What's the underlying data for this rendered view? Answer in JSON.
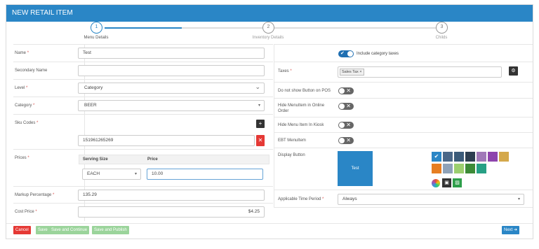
{
  "title": "NEW RETAIL ITEM",
  "steps": [
    {
      "num": "1",
      "label": "Menu Details"
    },
    {
      "num": "2",
      "label": "Inventory Details"
    },
    {
      "num": "3",
      "label": "Childs"
    }
  ],
  "form": {
    "name": {
      "label": "Name",
      "value": "Test"
    },
    "secondary_name": {
      "label": "Secondary Name",
      "value": ""
    },
    "level": {
      "label": "Level",
      "value": "Category"
    },
    "category": {
      "label": "Category",
      "value": "BEER"
    },
    "sku": {
      "label": "Sku Codes",
      "value": "151961265269"
    },
    "prices": {
      "label": "Prices",
      "col_size": "Serving Size",
      "col_price": "Price",
      "size": "EACH",
      "price": "10.00"
    },
    "markup": {
      "label": "Markup Percentage",
      "value": "135.29"
    },
    "cost": {
      "label": "Cost Price",
      "value": "$4.25"
    }
  },
  "right": {
    "include_taxes": "Include category taxes",
    "taxes": {
      "label": "Taxes",
      "tag": "Sales Tax ×"
    },
    "no_show_pos": "Do not show Button on POS",
    "hide_online": "Hide MenuItem in Online Order",
    "hide_kiosk": "Hide Menu Item In Kiosk",
    "ebt": "EBT MenuItem",
    "display_button": {
      "label": "Display Button",
      "preview": "Test"
    },
    "time_period": {
      "label": "Applicable Time Period",
      "value": "Always"
    }
  },
  "colors": {
    "primary": "#2a86c6",
    "preview": "#2a86c6",
    "swatches": [
      "#2a86c6",
      "#4a6788",
      "#3b5b7a",
      "#2d3e50",
      "#a078b8",
      "#8e44ad",
      "#d4a84b",
      "#e67e22",
      "#8fa2b8",
      "#9ccf6f",
      "#3d8b37",
      "#27a085"
    ]
  },
  "footer": {
    "cancel": "Cancel",
    "save": "Save",
    "save_continue": "Save and Continue",
    "save_publish": "Save and Publish",
    "next": "Next ➔"
  }
}
